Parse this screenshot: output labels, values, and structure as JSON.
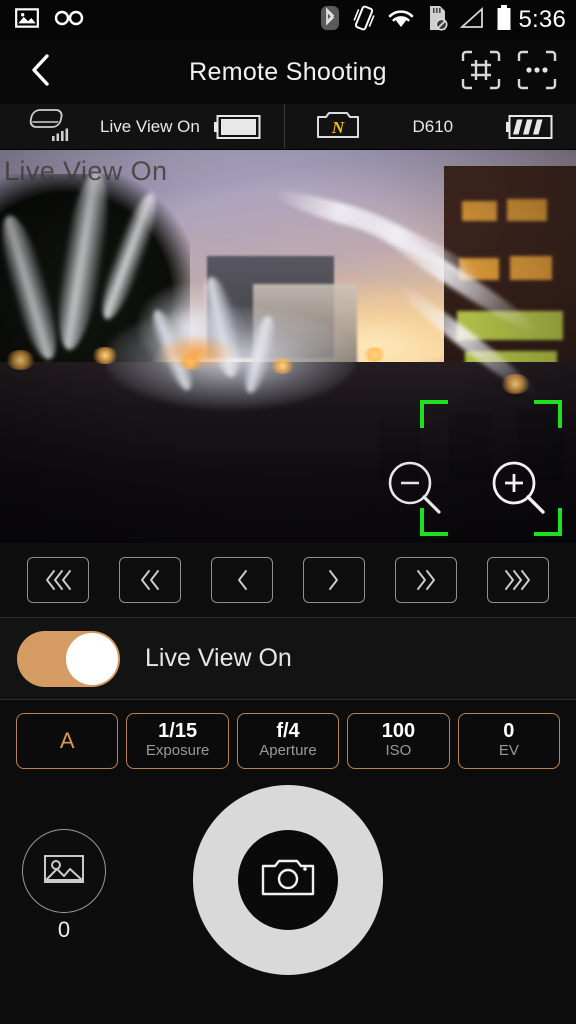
{
  "status_bar": {
    "time": "5:36",
    "icons": [
      {
        "name": "gallery-image-icon",
        "label": "image"
      },
      {
        "name": "voicemail-icon",
        "label": "voicemail"
      },
      {
        "name": "bluetooth-icon",
        "label": "bluetooth"
      },
      {
        "name": "vibrate-mode-icon",
        "label": "vibrate"
      },
      {
        "name": "wifi-icon",
        "label": "wifi"
      },
      {
        "name": "sd-card-disabled-icon",
        "label": "sd card unavailable"
      },
      {
        "name": "cellular-signal-icon",
        "label": "signal"
      },
      {
        "name": "battery-icon",
        "label": "battery"
      }
    ]
  },
  "header": {
    "title": "Remote Shooting",
    "back_icon": "chevron-left-icon",
    "grid_icon": "framing-grid-icon",
    "more_icon": "more-options-icon"
  },
  "info_bar": {
    "device": {
      "icon": "smart-device-signal-icon",
      "label": "Live View On",
      "battery_icon": "device-battery-icon"
    },
    "camera": {
      "icon": "nikon-camera-icon",
      "brand_mark": "N",
      "model": "D610",
      "battery_icon": "camera-battery-icon"
    }
  },
  "live_view": {
    "overlay_text": "Live View On",
    "af_frame_color": "#1fe01f",
    "zoom_out_icon": "zoom-out-icon",
    "zoom_in_icon": "zoom-in-icon"
  },
  "focus_controls": [
    {
      "name": "focus-far-fast-button",
      "icon": "chevron-triple-left-icon",
      "glyph": "‹‹‹"
    },
    {
      "name": "focus-far-medium-button",
      "icon": "chevron-double-left-icon",
      "glyph": "‹‹"
    },
    {
      "name": "focus-far-slow-button",
      "icon": "chevron-left-icon",
      "glyph": "‹"
    },
    {
      "name": "focus-near-slow-button",
      "icon": "chevron-right-icon",
      "glyph": "›"
    },
    {
      "name": "focus-near-medium-button",
      "icon": "chevron-double-right-icon",
      "glyph": "››"
    },
    {
      "name": "focus-near-fast-button",
      "icon": "chevron-triple-right-icon",
      "glyph": "›››"
    }
  ],
  "live_view_toggle": {
    "label": "Live View On",
    "state": "on",
    "track_color": "#d49b63",
    "knob_color": "#ffffff"
  },
  "exposure_settings": [
    {
      "name": "shooting-mode-card",
      "value": "A",
      "sub": "",
      "is_mode": true
    },
    {
      "name": "shutter-speed-card",
      "value": "1/15",
      "sub": "Exposure",
      "is_mode": false
    },
    {
      "name": "aperture-card",
      "value": "f/4",
      "sub": "Aperture",
      "is_mode": false
    },
    {
      "name": "iso-card",
      "value": "100",
      "sub": "ISO",
      "is_mode": false
    },
    {
      "name": "exposure-compensation-card",
      "value": "0",
      "sub": "EV",
      "is_mode": false
    }
  ],
  "bottom_bar": {
    "gallery_icon": "photo-gallery-icon",
    "gallery_count": "0",
    "shutter_icon": "camera-shutter-icon"
  },
  "colors": {
    "accent": "#d49b63",
    "card_border": "#b9834c",
    "af_green": "#1fe01f",
    "background": "#0c0c0c",
    "shutter_ring": "#d9d9d9"
  }
}
